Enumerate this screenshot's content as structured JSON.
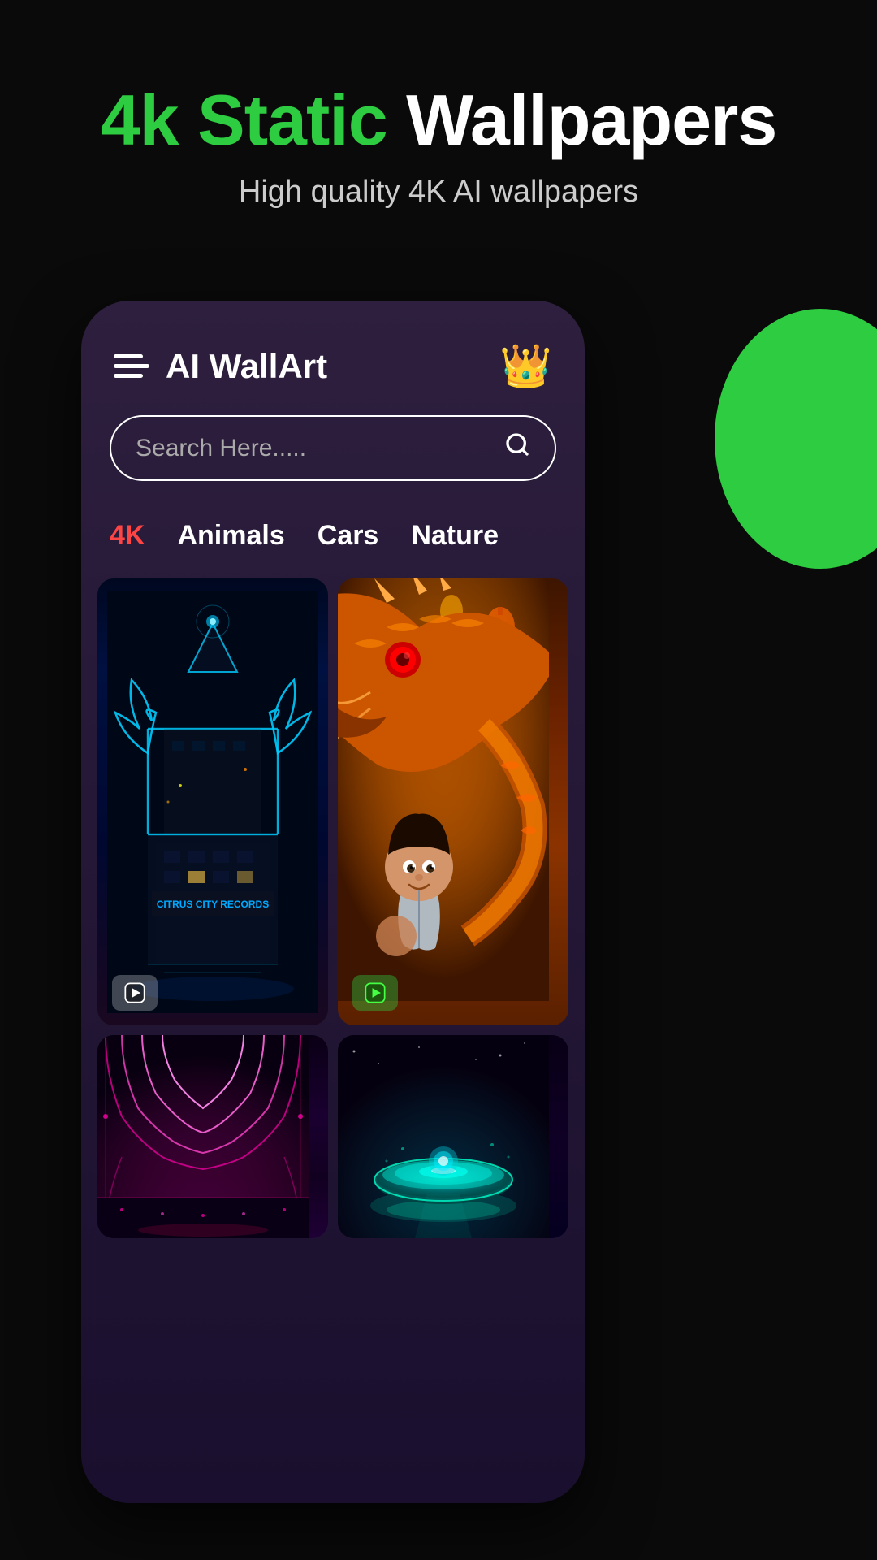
{
  "hero": {
    "title_highlight": "4k Static",
    "title_rest": " Wallpapers",
    "subtitle": "High quality 4K AI wallpapers"
  },
  "app": {
    "name": "AI WallArt",
    "crown_emoji": "👑",
    "search_placeholder": "Search Here.....",
    "tabs": [
      {
        "label": "4K",
        "active": true
      },
      {
        "label": "Animals",
        "active": false
      },
      {
        "label": "Cars",
        "active": false
      },
      {
        "label": "Nature",
        "active": false
      }
    ]
  },
  "wallpapers": [
    {
      "id": 1,
      "type": "neon-building",
      "has_play": true,
      "play_type": "dark"
    },
    {
      "id": 2,
      "type": "dragon",
      "has_play": true,
      "play_type": "green"
    },
    {
      "id": 3,
      "type": "pink-neon",
      "has_play": false
    },
    {
      "id": 4,
      "type": "purple-teal",
      "has_play": false
    }
  ],
  "icons": {
    "search": "🔍",
    "hamburger": "☰",
    "play": "▶"
  },
  "colors": {
    "green_accent": "#2ecc40",
    "red_tab": "#ff4444",
    "background": "#0a0a0a",
    "app_bg": "#2d1f3d"
  }
}
